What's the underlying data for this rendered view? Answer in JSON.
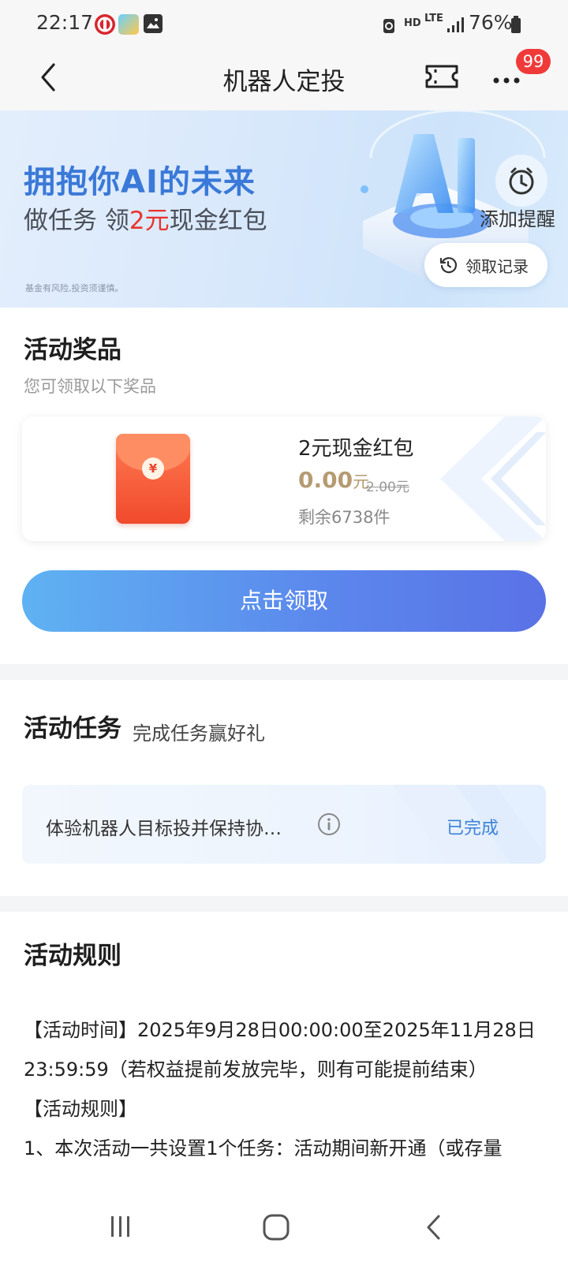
{
  "status_bar": {
    "time": "22:17",
    "network": "HD",
    "lte": "LTE",
    "battery": "76%"
  },
  "nav": {
    "title": "机器人定投",
    "badge_count": "99"
  },
  "banner": {
    "headline": "拥抱你AI的未来",
    "sub_prefix": "做任务 领",
    "sub_amount": "2元",
    "sub_suffix": "现金红包",
    "risk_note": "基金有风险,投资须谨慎。",
    "remind_label": "添加提醒",
    "record_label": "领取记录"
  },
  "prizes": {
    "title": "活动奖品",
    "subtitle": "您可领取以下奖品",
    "item": {
      "name": "2元现金红包",
      "price": "0.00",
      "price_unit": "元",
      "original_price": "2.00元",
      "stock": "剩余6738件"
    },
    "claim_button": "点击领取"
  },
  "tasks": {
    "title": "活动任务",
    "subtitle": "完成任务赢好礼",
    "items": [
      {
        "text": "体验机器人目标投并保持协…",
        "status": "已完成"
      }
    ]
  },
  "rules": {
    "title": "活动规则",
    "lines": [
      "【活动时间】2025年9月28日00:00:00至2025年11月28日",
      "23:59:59（若权益提前发放完毕，则有可能提前结束）",
      "【活动规则】",
      "1、本次活动一共设置1个任务：活动期间新开通（或存量"
    ]
  },
  "colors": {
    "accent_blue": "#3a79d8",
    "button_gradient_start": "#5fb2f2",
    "button_gradient_end": "#5a72e6",
    "badge_red": "#f03a3a",
    "price_gold": "#b59a72"
  }
}
